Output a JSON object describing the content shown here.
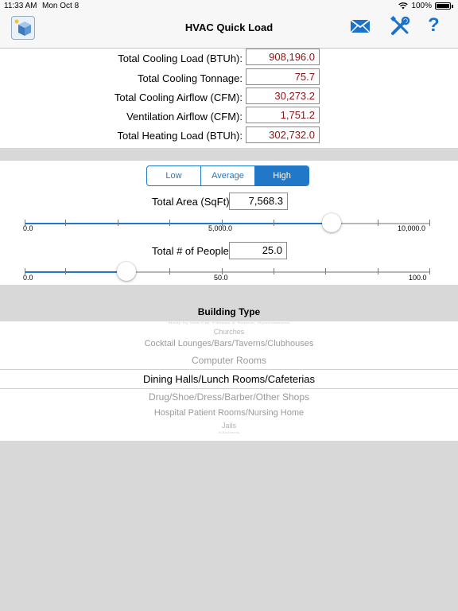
{
  "status": {
    "time": "11:33 AM",
    "date": "Mon Oct 8",
    "battery": "100%"
  },
  "nav": {
    "title": "HVAC Quick Load",
    "icons": [
      "app-icon",
      "mail-icon",
      "tools-icon",
      "help-icon"
    ],
    "help_label": "?"
  },
  "results": [
    {
      "label": "Total Cooling Load (BTUh):",
      "value": "908,196.0"
    },
    {
      "label": "Total Cooling Tonnage:",
      "value": "75.7"
    },
    {
      "label": "Total Cooling Airflow (CFM):",
      "value": "30,273.2"
    },
    {
      "label": "Ventilation Airflow (CFM):",
      "value": "1,751.2"
    },
    {
      "label": "Total Heating Load (BTUh):",
      "value": "302,732.0"
    }
  ],
  "segment": {
    "options": [
      "Low",
      "Average",
      "High"
    ],
    "selected": "High"
  },
  "area": {
    "label": "Total Area (SqFt):",
    "value": "7,568.3",
    "slider": {
      "min_label": "0.0",
      "mid_label": "5,000.0",
      "max_label": "10,000.0",
      "min": 0,
      "max": 10000,
      "value": 7568.3
    }
  },
  "people": {
    "label": "Total # of People:",
    "value": "25.0",
    "slider": {
      "min_label": "0.0",
      "mid_label": "50.0",
      "max_label": "100.0",
      "min": 0,
      "max": 100,
      "value": 25
    }
  },
  "building": {
    "header": "Building Type",
    "items": [
      "Body by Mid-Cal, Fitness & Salons, Gymnasiums",
      "Churches",
      "Cocktail Lounges/Bars/Taverns/Clubhouses",
      "Computer Rooms",
      "Dining Halls/Lunch Rooms/Cafeterias",
      "Drug/Shoe/Dress/Barber/Other Shops",
      "Hospital Patient Rooms/Nursing Home",
      "Jails",
      "Kitchens"
    ],
    "selected": "Dining Halls/Lunch Rooms/Cafeterias"
  },
  "colors": {
    "accent": "#2278c8",
    "value_text": "#8b1313",
    "background": "#d8d8d8"
  }
}
